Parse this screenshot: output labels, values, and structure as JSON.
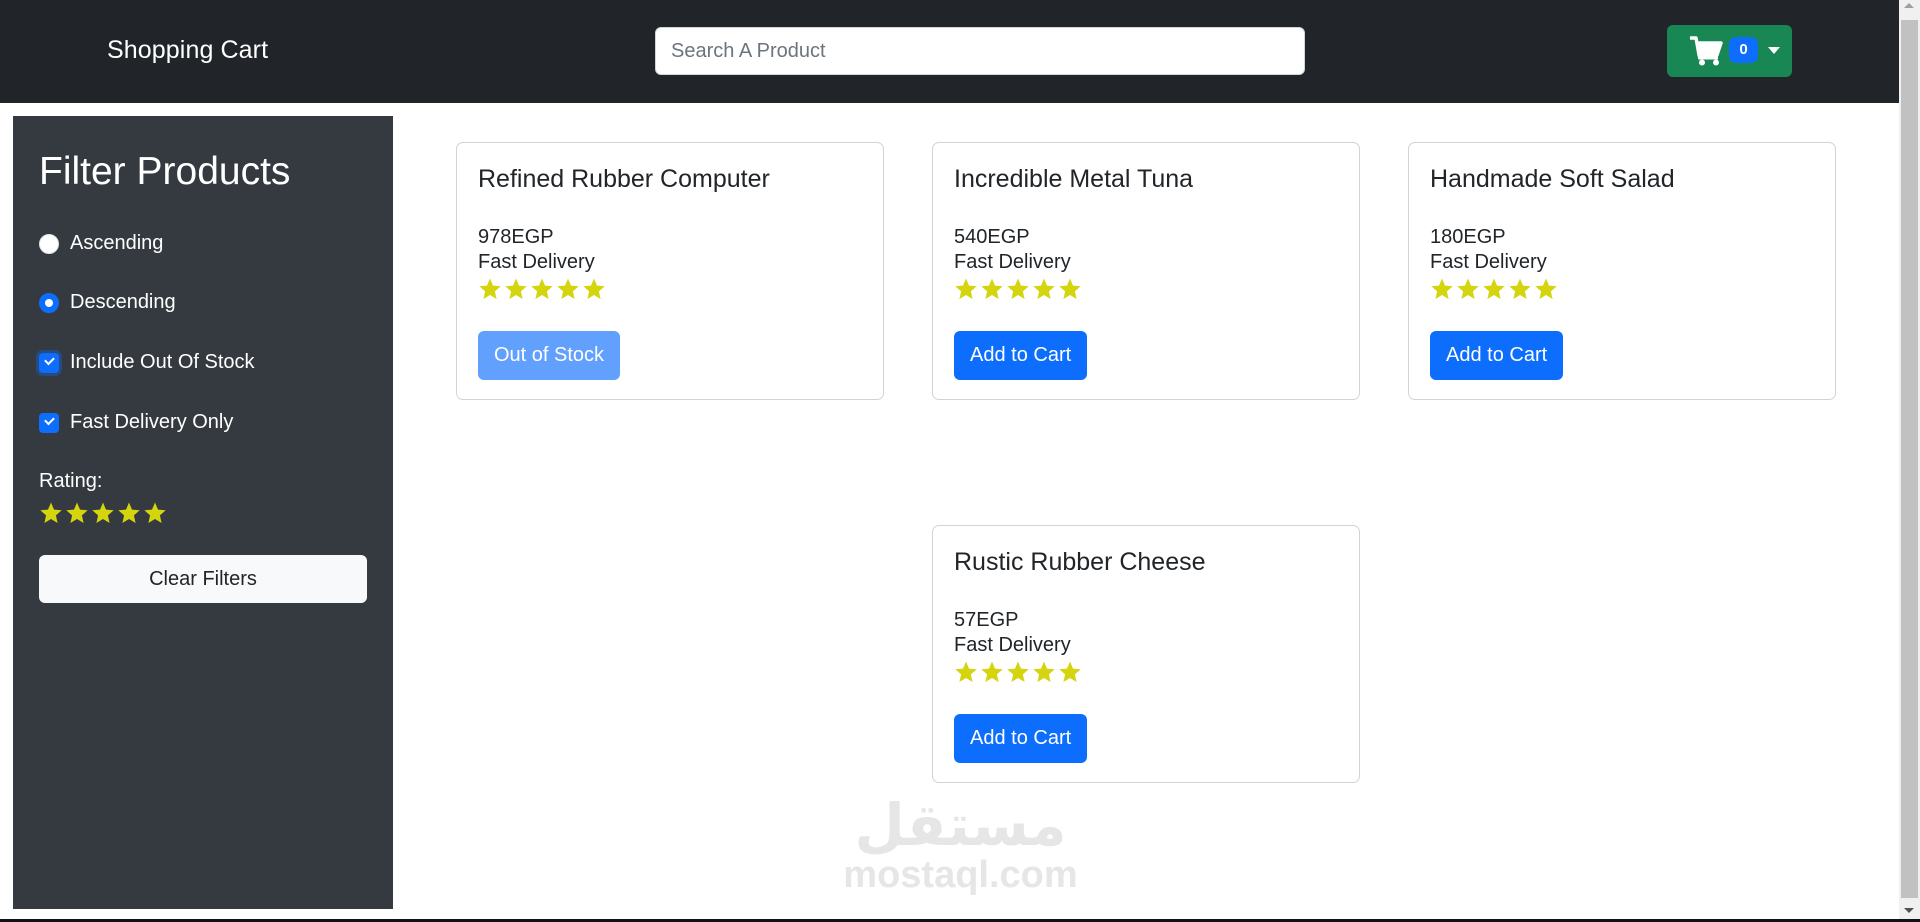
{
  "header": {
    "brand": "Shopping Cart",
    "search_placeholder": "Search A Product",
    "search_value": "",
    "cart_count": "0",
    "cart_icon": "shopping-cart-icon",
    "dropdown_icon": "caret-down-icon"
  },
  "sidebar": {
    "title": "Filter Products",
    "sort_options": [
      {
        "label": "Ascending",
        "checked": false
      },
      {
        "label": "Descending",
        "checked": true
      }
    ],
    "checkboxes": [
      {
        "label": "Include Out Of Stock",
        "checked": true
      },
      {
        "label": "Fast Delivery Only",
        "checked": true
      }
    ],
    "rating_label": "Rating:",
    "rating": 5,
    "rating_max": 5,
    "clear_label": "Clear Filters"
  },
  "products": [
    {
      "name": "Refined Rubber Computer",
      "price": "978EGP",
      "delivery": "Fast Delivery",
      "rating": 5,
      "button": "Out of Stock",
      "in_stock": false
    },
    {
      "name": "Incredible Metal Tuna",
      "price": "540EGP",
      "delivery": "Fast Delivery",
      "rating": 5,
      "button": "Add to Cart",
      "in_stock": true
    },
    {
      "name": "Handmade Soft Salad",
      "price": "180EGP",
      "delivery": "Fast Delivery",
      "rating": 5,
      "button": "Add to Cart",
      "in_stock": true
    },
    {
      "name": "Rustic Rubber Cheese",
      "price": "57EGP",
      "delivery": "Fast Delivery",
      "rating": 5,
      "button": "Add to Cart",
      "in_stock": true
    }
  ],
  "watermark": {
    "arabic": "مستقل",
    "text": "mostaql.com"
  },
  "colors": {
    "header_bg": "#212529",
    "sidebar_bg": "#343a40",
    "primary": "#0d6efd",
    "primary_disabled": "#62a0fd",
    "success": "#198754",
    "star": "#d4d40f"
  }
}
